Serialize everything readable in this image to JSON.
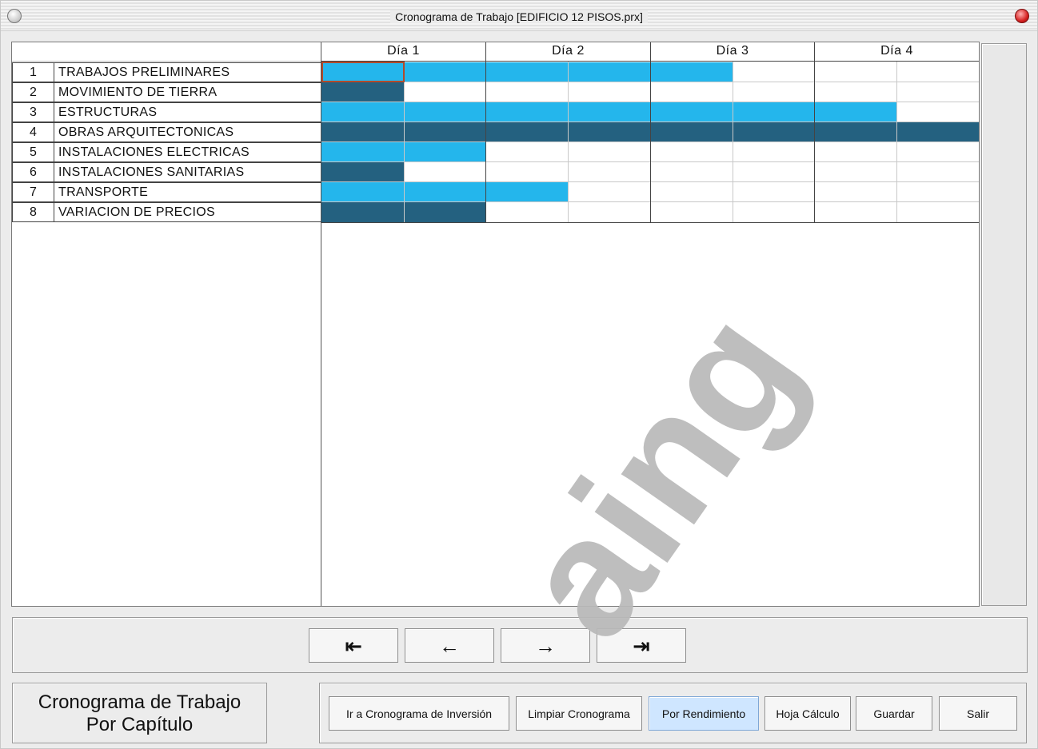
{
  "window": {
    "title": "Cronograma de Trabajo [EDIFICIO 12 PISOS.prx]"
  },
  "gantt": {
    "days": [
      "Día 1",
      "Día 2",
      "Día 3",
      "Día 4"
    ],
    "tasks": [
      {
        "num": "1",
        "name": "TRABAJOS PRELIMINARES"
      },
      {
        "num": "2",
        "name": "MOVIMIENTO DE TIERRA"
      },
      {
        "num": "3",
        "name": "ESTRUCTURAS"
      },
      {
        "num": "4",
        "name": "OBRAS ARQUITECTONICAS"
      },
      {
        "num": "5",
        "name": "INSTALACIONES ELECTRICAS"
      },
      {
        "num": "6",
        "name": "INSTALACIONES SANITARIAS"
      },
      {
        "num": "7",
        "name": "TRANSPORTE"
      },
      {
        "num": "8",
        "name": "VARIACION DE PRECIOS"
      }
    ],
    "colors": {
      "light_bar": "#24b6ec",
      "dark_bar": "#246180",
      "selection": "#b24a2a"
    }
  },
  "navigation": {
    "first_icon": "first-page-icon",
    "prev_icon": "arrow-left-icon",
    "next_icon": "arrow-right-icon",
    "last_icon": "last-page-icon"
  },
  "footer": {
    "label_line1": "Cronograma de Trabajo",
    "label_line2": "Por Capítulo",
    "buttons": {
      "inversion": "Ir a Cronograma de Inversión",
      "limpiar": "Limpiar Cronograma",
      "rendimiento": "Por Rendimiento",
      "hoja": "Hoja Cálculo",
      "guardar": "Guardar",
      "salir": "Salir"
    }
  },
  "watermark": "aing"
}
